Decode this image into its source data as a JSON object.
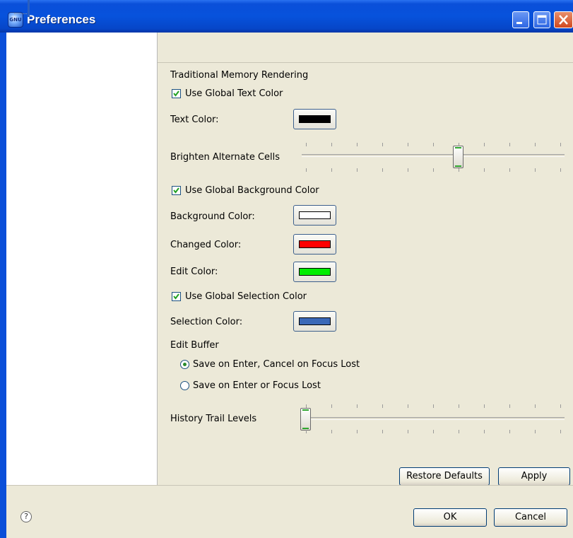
{
  "window": {
    "title": "Preferences",
    "app_icon_text": "GNU"
  },
  "section": {
    "title": "Traditional Memory Rendering"
  },
  "options": {
    "use_global_text_color": {
      "label": "Use Global Text Color",
      "checked": true
    },
    "text_color": {
      "label": "Text Color:",
      "color": "#000000"
    },
    "brighten_alternate_cells": {
      "label": "Brighten Alternate Cells",
      "level": 0.6
    },
    "use_global_background_color": {
      "label": "Use Global Background Color",
      "checked": true
    },
    "background_color": {
      "label": "Background Color:",
      "color": "#ffffff"
    },
    "changed_color": {
      "label": "Changed Color:",
      "color": "#ff0000"
    },
    "edit_color": {
      "label": "Edit Color:",
      "color": "#00ee00"
    },
    "use_global_selection_color": {
      "label": "Use Global Selection Color",
      "checked": true
    },
    "selection_color": {
      "label": "Selection Color:",
      "color": "#3a68b8"
    },
    "edit_buffer": {
      "label": "Edit Buffer",
      "options": [
        {
          "label": "Save on Enter, Cancel on Focus Lost",
          "selected": true
        },
        {
          "label": "Save on Enter or Focus Lost",
          "selected": false
        }
      ]
    },
    "history_trail_levels": {
      "label": "History Trail Levels",
      "level": 0
    }
  },
  "buttons": {
    "restore_defaults": "Restore Defaults",
    "apply": "Apply",
    "ok": "OK",
    "cancel": "Cancel"
  },
  "icons": {
    "help": "?"
  }
}
